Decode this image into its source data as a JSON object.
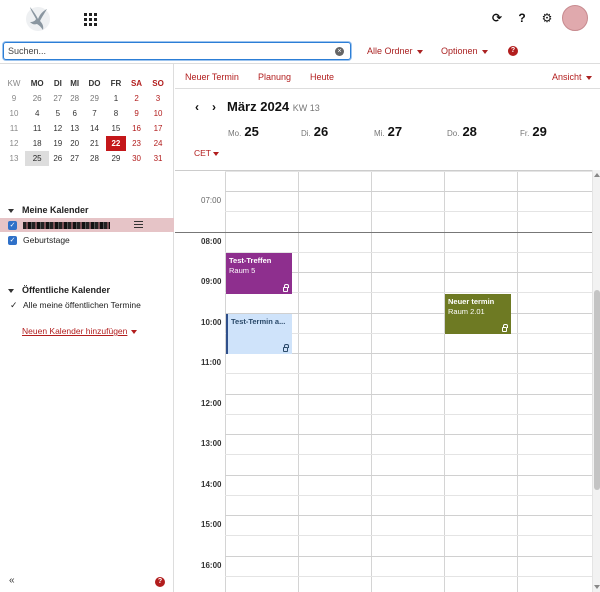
{
  "search": {
    "placeholder": "Suchen..."
  },
  "search_bar": {
    "all_folders": "Alle Ordner",
    "options": "Optionen",
    "help": "?"
  },
  "mini_calendar": {
    "headers": [
      "KW",
      "MO",
      "DI",
      "MI",
      "DO",
      "FR",
      "SA",
      "SO"
    ],
    "weeks": [
      [
        "9",
        "26",
        "27",
        "28",
        "29",
        "1",
        "2",
        "3"
      ],
      [
        "10",
        "4",
        "5",
        "6",
        "7",
        "8",
        "9",
        "10"
      ],
      [
        "11",
        "11",
        "12",
        "13",
        "14",
        "15",
        "16",
        "17"
      ],
      [
        "12",
        "18",
        "19",
        "20",
        "21",
        "22",
        "23",
        "24"
      ],
      [
        "13",
        "25",
        "26",
        "27",
        "28",
        "29",
        "30",
        "31"
      ]
    ],
    "today": "22",
    "selected": "25"
  },
  "sidebar": {
    "my_calendars_title": "Meine Kalender",
    "calendars": [
      {
        "label": "",
        "redacted": true
      },
      {
        "label": "Geburtstage"
      }
    ],
    "add_calendar": "Neuen Kalender hinzufügen",
    "public_calendars_title": "Öffentliche Kalender",
    "public_item": "Alle meine öffentlichen Termine",
    "collapse_icon": "«",
    "help": "?"
  },
  "toolbar": {
    "new_appointment": "Neuer Termin",
    "planning": "Planung",
    "today": "Heute",
    "view": "Ansicht"
  },
  "nav": {
    "prev": "‹",
    "next": "›",
    "month": "März 2024",
    "week": "KW 13"
  },
  "days": [
    {
      "dow": "Mo.",
      "date": "25"
    },
    {
      "dow": "Di.",
      "date": "26"
    },
    {
      "dow": "Mi.",
      "date": "27"
    },
    {
      "dow": "Do.",
      "date": "28"
    },
    {
      "dow": "Fr.",
      "date": "29"
    }
  ],
  "timezone": "CET",
  "times": [
    "07:00",
    "08:00",
    "09:00",
    "10:00",
    "11:00",
    "12:00",
    "13:00",
    "14:00",
    "15:00",
    "16:00"
  ],
  "events": [
    {
      "title": "Test-Treffen",
      "location": "Raum 5",
      "color": "#8e2f8e"
    },
    {
      "title": "Test-Termin a...",
      "location": "",
      "color": "#cfe3fa"
    },
    {
      "title": "Neuer termin",
      "location": "Raum 2.01",
      "color": "#6e7a23"
    }
  ],
  "colors": {
    "accent": "#b21d1d",
    "today": "#c4171a",
    "selection": "#2f70c8"
  }
}
